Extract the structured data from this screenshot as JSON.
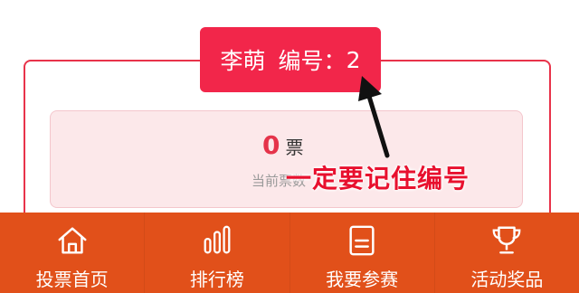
{
  "contestant": {
    "name": "李萌",
    "number_label": "编号：",
    "number": "2"
  },
  "votes": {
    "count": "0",
    "unit": "票",
    "label": "当前票数"
  },
  "annotation": {
    "text": "一定要记住编号",
    "color": "#e8102e"
  },
  "bottom_nav": {
    "items": [
      {
        "label": "投票首页",
        "icon": "home-icon"
      },
      {
        "label": "排行榜",
        "icon": "bar-chart-icon"
      },
      {
        "label": "我要参赛",
        "icon": "form-icon"
      },
      {
        "label": "活动奖品",
        "icon": "trophy-icon"
      }
    ]
  },
  "colors": {
    "accent": "#f2264a",
    "nav_background": "#e1501a",
    "vote_box": "#fce8ea"
  }
}
